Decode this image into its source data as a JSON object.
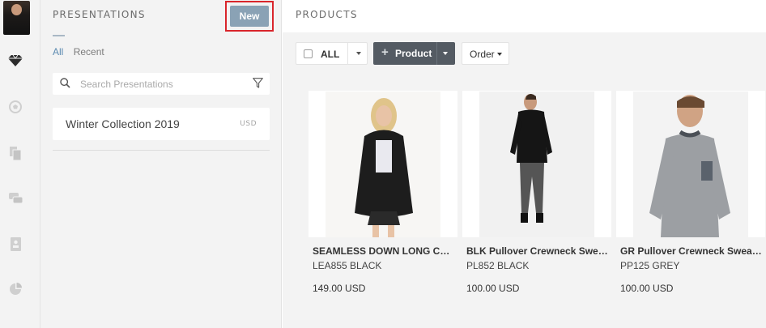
{
  "presentations_panel": {
    "title": "PRESENTATIONS",
    "new_button": "New",
    "tabs": [
      {
        "label": "All",
        "active": true
      },
      {
        "label": "Recent",
        "active": false
      }
    ],
    "search": {
      "placeholder": "Search Presentations"
    },
    "items": [
      {
        "name": "Winter Collection 2019",
        "currency": "USD"
      }
    ]
  },
  "sidebar": {
    "icons": [
      "diamond-icon",
      "soccer-ball-icon",
      "documents-icon",
      "chat-icon",
      "contact-card-icon",
      "pie-chart-icon"
    ]
  },
  "products": {
    "title": "PRODUCTS",
    "toolbar": {
      "select_all_label": "ALL",
      "add_product_label": "Product",
      "order_label": "Order"
    },
    "items": [
      {
        "name": "SEAMLESS DOWN LONG COAT",
        "code": "LEA855 BLACK",
        "price": "149.00 USD"
      },
      {
        "name": "BLK Pullover Crewneck Sweat...",
        "code": "PL852 BLACK",
        "price": "100.00 USD"
      },
      {
        "name": "GR Pullover Crewneck Sweate...",
        "code": "PP125 GREY",
        "price": "100.00 USD"
      }
    ]
  },
  "colors": {
    "accent_blue": "#8aa2b5",
    "highlight_red": "#d9252b",
    "dark_button": "#545b63",
    "panel_bg": "#f3f3f3"
  }
}
